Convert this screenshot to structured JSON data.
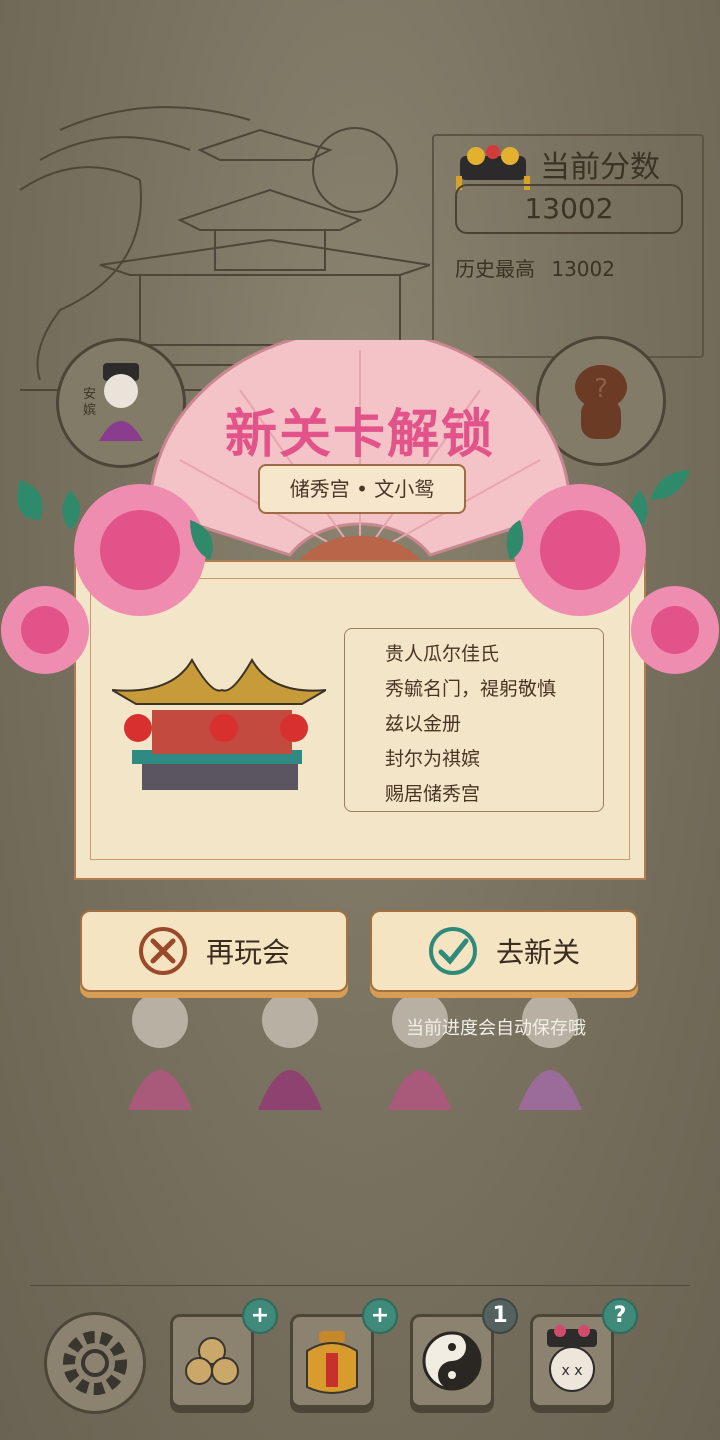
{
  "score": {
    "title": "当前分数",
    "value": "13002",
    "best_label": "历史最高",
    "best_value": "13002"
  },
  "avatars": {
    "left_label": "安嫔",
    "unknown_icon": "question-mark"
  },
  "unlock": {
    "title": "新关卡解锁",
    "subtitle": "储秀宫 • 文小鸳"
  },
  "decree": {
    "lines": [
      "贵人瓜尔佳氏",
      "秀毓名门，禔躬敬慎",
      "兹以金册",
      "封尔为祺嫔",
      "赐居储秀宫"
    ]
  },
  "buttons": {
    "replay": "再玩会",
    "next": "去新关"
  },
  "note": "当前进度会自动保存哦",
  "tools": {
    "yinyang_count": "1",
    "plus": "+",
    "help": "?"
  },
  "colors": {
    "accent_pink": "#e2538a",
    "button_border": "#a4703f",
    "badge_teal": "#3f8a7a"
  }
}
